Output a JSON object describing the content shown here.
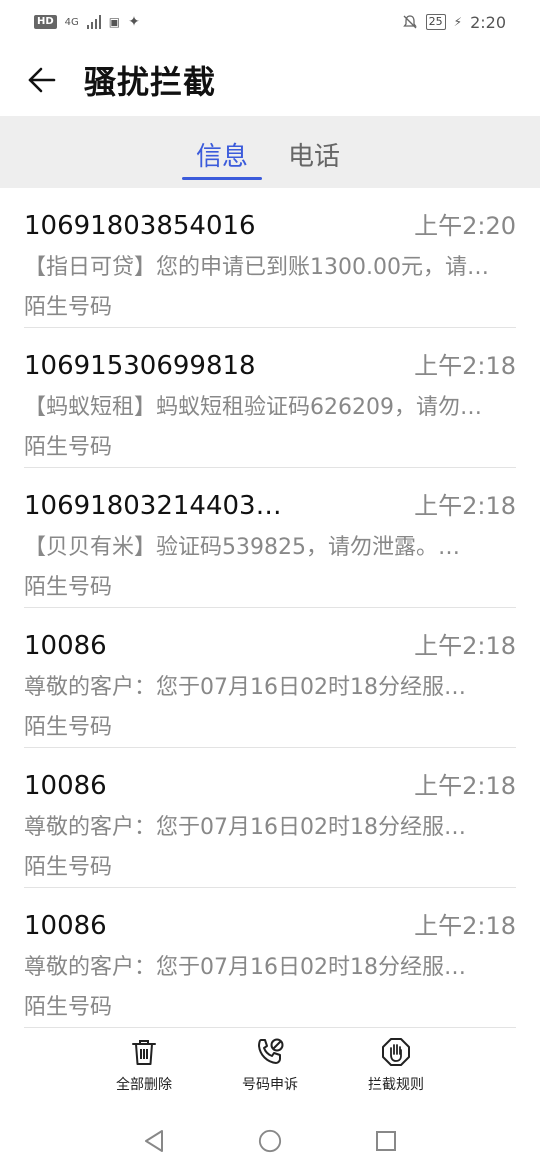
{
  "status_bar": {
    "left_badge": "HD",
    "network": "4G",
    "battery": "25",
    "time": "2:20"
  },
  "header": {
    "back_icon": "arrow-left-icon",
    "title": "骚扰拦截"
  },
  "tabs": [
    {
      "label": "信息",
      "active": true
    },
    {
      "label": "电话",
      "active": false
    }
  ],
  "messages": [
    {
      "sender": "10691803854016",
      "time": "上午2:20",
      "preview": "【指日可贷】您的申请已到账1300.00元，请…",
      "tag": "陌生号码"
    },
    {
      "sender": "10691530699818",
      "time": "上午2:18",
      "preview": "【蚂蚁短租】蚂蚁短租验证码626209，请勿…",
      "tag": "陌生号码"
    },
    {
      "sender": "10691803214403…",
      "time": "上午2:18",
      "preview": "【贝贝有米】验证码539825，请勿泄露。…",
      "tag": "陌生号码"
    },
    {
      "sender": "10086",
      "time": "上午2:18",
      "preview": "尊敬的客户：您于07月16日02时18分经服…",
      "tag": "陌生号码"
    },
    {
      "sender": "10086",
      "time": "上午2:18",
      "preview": "尊敬的客户：您于07月16日02时18分经服…",
      "tag": "陌生号码"
    },
    {
      "sender": "10086",
      "time": "上午2:18",
      "preview": "尊敬的客户：您于07月16日02时18分经服…",
      "tag": "陌生号码"
    }
  ],
  "toolbar": {
    "delete_all": "全部删除",
    "appeal": "号码申诉",
    "rules": "拦截规则"
  },
  "colors": {
    "accent": "#3b5bdb",
    "tab_bar_bg": "#eeeeee",
    "secondary_text": "#888888"
  }
}
